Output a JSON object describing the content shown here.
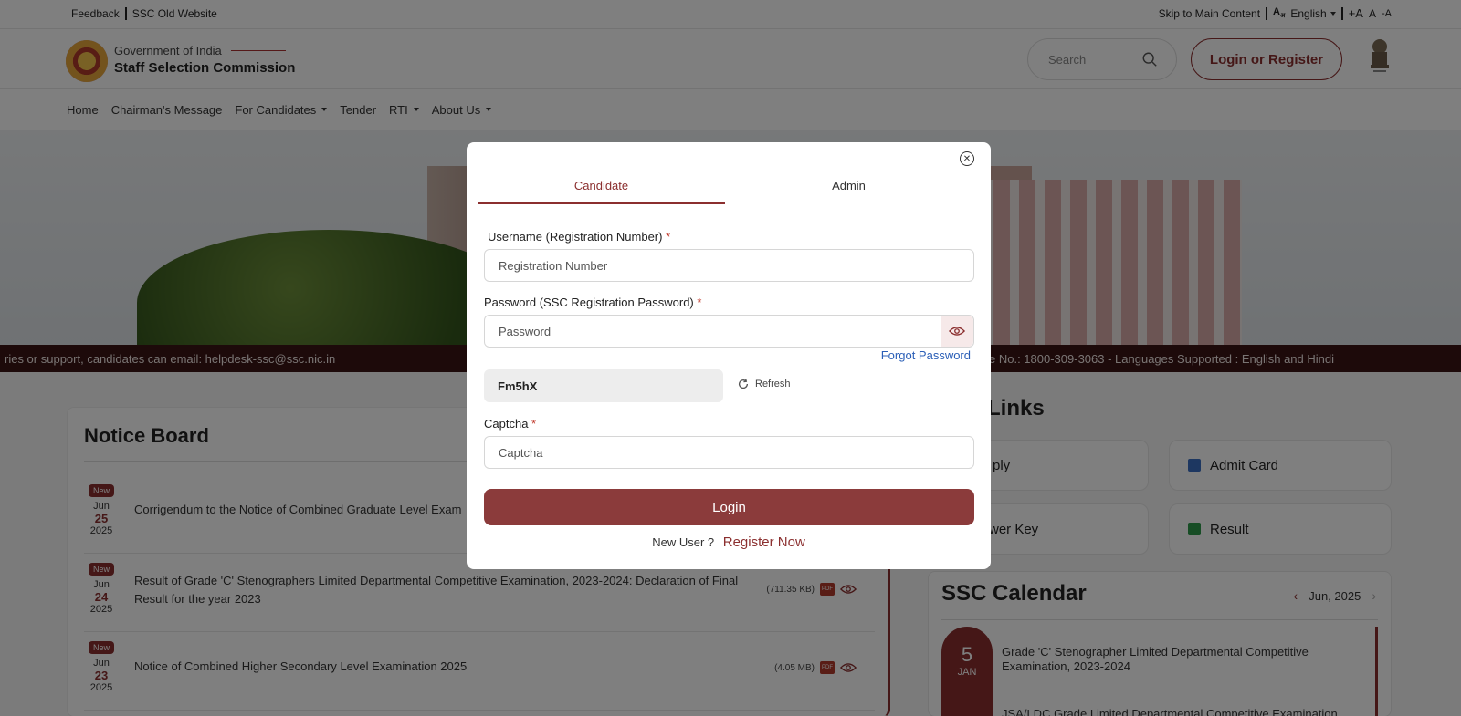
{
  "topbar": {
    "feedback": "Feedback",
    "old_website": "SSC Old Website",
    "skip": "Skip to Main Content",
    "language": "English",
    "font_increase": "+A",
    "font_normal": "A",
    "font_decrease": "-A"
  },
  "header": {
    "org_line1": "Government of India",
    "org_line2": "Staff Selection Commission",
    "search_placeholder": "Search",
    "login_register": "Login or Register"
  },
  "nav": {
    "home": "Home",
    "chairman": "Chairman's Message",
    "candidates": "For Candidates",
    "tender": "Tender",
    "rti": "RTI",
    "about": "About Us"
  },
  "ticker": {
    "left": "ries or support, candidates can email: helpdesk-ssc@ssc.nic.in",
    "right": "line No.: 1800-309-3063 - Languages Supported : English and Hindi"
  },
  "notice_board": {
    "title": "Notice Board",
    "badge": "New",
    "items": [
      {
        "month": "Jun",
        "day": "25",
        "year": "2025",
        "text": "Corrigendum to the Notice of Combined Graduate Level Exam",
        "size": ""
      },
      {
        "month": "Jun",
        "day": "24",
        "year": "2025",
        "text": "Result of Grade 'C' Stenographers Limited Departmental Competitive Examination, 2023-2024: Declaration of Final Result for the year 2023",
        "size": "(711.35 KB)"
      },
      {
        "month": "Jun",
        "day": "23",
        "year": "2025",
        "text": "Notice of Combined Higher Secondary Level Examination 2025",
        "size": "(4.05 MB)"
      }
    ]
  },
  "quick_links": {
    "title_fragment": "Links",
    "apply_fragment": "ply",
    "admit_card": "Admit Card",
    "answer_key_fragment": "wer Key",
    "result": "Result"
  },
  "calendar": {
    "title": "SSC Calendar",
    "month": "Jun, 2025",
    "date_day": "5",
    "date_month": "JAN",
    "event": "Grade 'C' Stenographer Limited Departmental Competitive Examination, 2023-2024",
    "event2": "JSA/LDC Grade Limited Departmental Competitive Examination"
  },
  "modal": {
    "tab_candidate": "Candidate",
    "tab_admin": "Admin",
    "username_label": "Username (Registration Number)",
    "username_placeholder": "Registration Number",
    "password_label": "Password (SSC Registration Password)",
    "password_placeholder": "Password",
    "forgot": "Forgot Password",
    "captcha_value": "Fm5hX",
    "refresh": "Refresh",
    "captcha_label": "Captcha",
    "captcha_placeholder": "Captcha",
    "login": "Login",
    "new_user": "New User ?",
    "register_now": "Register Now",
    "required_mark": "*"
  },
  "colors": {
    "brand": "#8b2f2f",
    "link": "#2b5fb7"
  }
}
